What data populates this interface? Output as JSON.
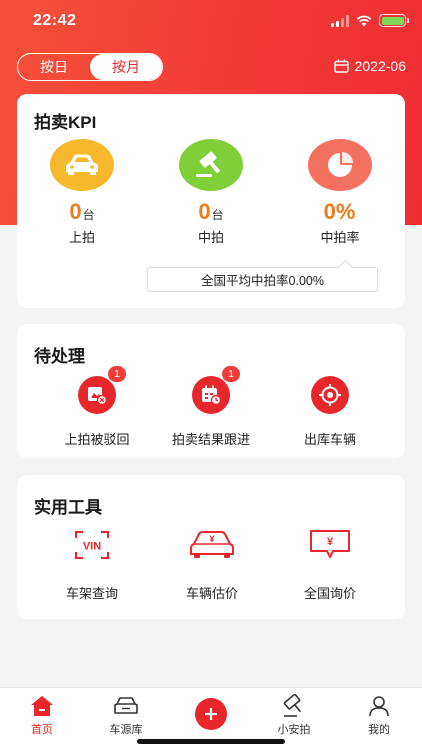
{
  "status_bar": {
    "time": "22:42"
  },
  "filter": {
    "day_label": "按日",
    "month_label": "按月",
    "selected": "按月",
    "date": "2022-06"
  },
  "kpi": {
    "title": "拍卖KPI",
    "items": [
      {
        "value": "0",
        "unit": "台",
        "label": "上拍",
        "icon": "car-icon",
        "color": "#f6b82c"
      },
      {
        "value": "0",
        "unit": "台",
        "label": "中拍",
        "icon": "gavel-icon",
        "color": "#7fcf38"
      },
      {
        "value": "0%",
        "unit": "",
        "label": "中拍率",
        "icon": "pie-chart-icon",
        "color": "#f47160"
      }
    ],
    "national_avg": "全国平均中拍率0.00%"
  },
  "todo": {
    "title": "待处理",
    "items": [
      {
        "label": "上拍被驳回",
        "badge": "1",
        "icon": "rejected-listing-icon"
      },
      {
        "label": "拍卖结果跟进",
        "badge": "1",
        "icon": "calendar-followup-icon"
      },
      {
        "label": "出库车辆",
        "badge": "",
        "icon": "target-icon"
      }
    ]
  },
  "tools": {
    "title": "实用工具",
    "items": [
      {
        "label": "车架查询",
        "icon": "vin-scan-icon",
        "icon_text": "VIN"
      },
      {
        "label": "车辆估价",
        "icon": "car-price-icon",
        "icon_text": "¥"
      },
      {
        "label": "全国询价",
        "icon": "price-inquiry-icon",
        "icon_text": "¥"
      }
    ]
  },
  "tabbar": {
    "items": [
      {
        "label": "首页",
        "icon": "home-icon",
        "active": true
      },
      {
        "label": "车源库",
        "icon": "car-library-icon",
        "active": false
      },
      {
        "label": "",
        "icon": "add-icon",
        "active": false
      },
      {
        "label": "小安拍",
        "icon": "auction-icon",
        "active": false
      },
      {
        "label": "我的",
        "icon": "profile-icon",
        "active": false
      }
    ]
  },
  "colors": {
    "brand_red": "#e8262c",
    "kpi_value": "#f07b1b"
  }
}
